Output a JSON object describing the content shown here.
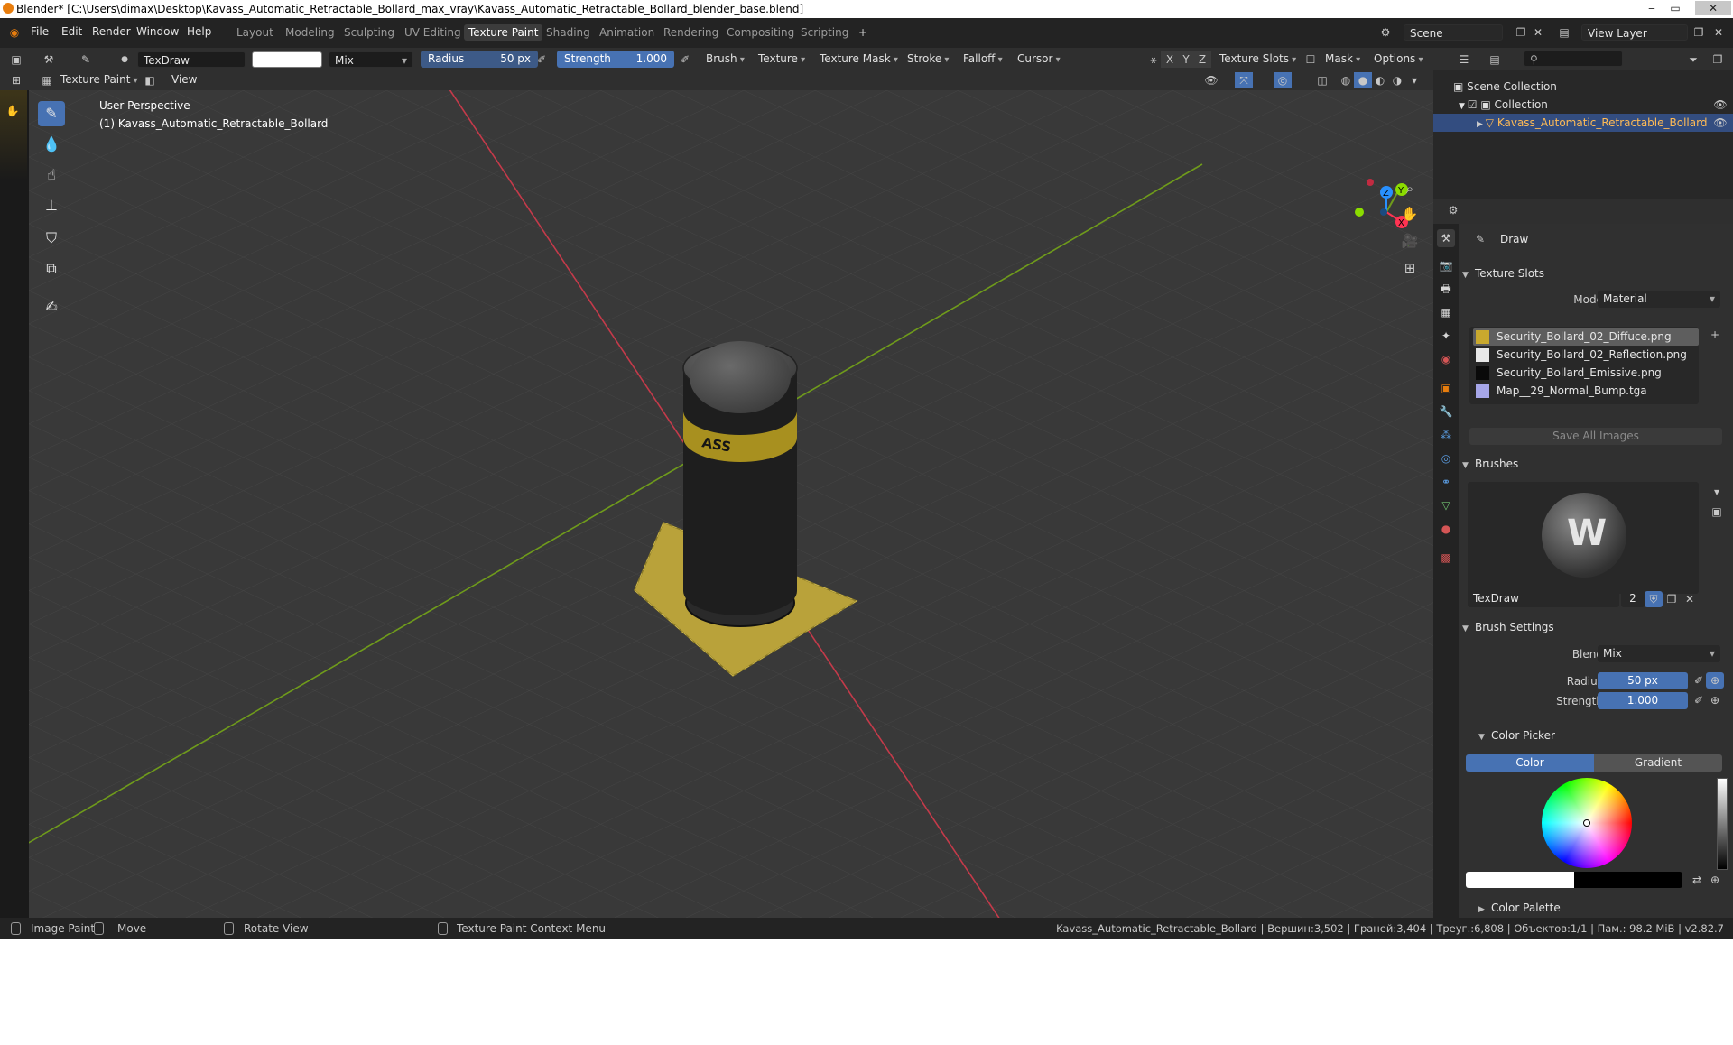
{
  "window": {
    "title": "Blender* [C:\\Users\\dimax\\Desktop\\Kavass_Automatic_Retractable_Bollard_max_vray\\Kavass_Automatic_Retractable_Bollard_blender_base.blend]",
    "minimize": "‒",
    "maximize": "▭",
    "close": "✕"
  },
  "menu": {
    "file": "File",
    "edit": "Edit",
    "render": "Render",
    "window": "Window",
    "help": "Help"
  },
  "workspaces": [
    "Layout",
    "Modeling",
    "Sculpting",
    "UV Editing",
    "Texture Paint",
    "Shading",
    "Animation",
    "Rendering",
    "Compositing",
    "Scripting"
  ],
  "active_workspace": "Texture Paint",
  "add_workspace": "+",
  "scene": {
    "name": "Scene",
    "view_layer": "View Layer"
  },
  "toolheader": {
    "brush_name": "TexDraw",
    "blend": "Mix",
    "radius_label": "Radius",
    "radius_value": "50 px",
    "strength_label": "Strength",
    "strength_value": "1.000",
    "brush": "Brush",
    "texture": "Texture",
    "texture_mask": "Texture Mask",
    "stroke": "Stroke",
    "falloff": "Falloff",
    "cursor": "Cursor",
    "axis_x": "X",
    "axis_y": "Y",
    "axis_z": "Z",
    "texture_slots": "Texture Slots",
    "mask": "Mask",
    "options": "Options"
  },
  "viewheader": {
    "mode": "Texture Paint",
    "view": "View"
  },
  "viewport": {
    "perspective": "User Perspective",
    "object": "(1) Kavass_Automatic_Retractable_Bollard",
    "bollard_text": "ASS",
    "gizmo": {
      "x": "X",
      "y": "Y",
      "z": "Z"
    }
  },
  "outliner": {
    "scene_collection": "Scene Collection",
    "collection": "Collection",
    "object": "Kavass_Automatic_Retractable_Bollard"
  },
  "properties": {
    "tool_name": "Draw",
    "texture_slots_title": "Texture Slots",
    "mode_label": "Mode",
    "mode_value": "Material",
    "slots": [
      {
        "name": "Security_Bollard_02_Diffuce.png",
        "color": "#c9a92e"
      },
      {
        "name": "Security_Bollard_02_Reflection.png",
        "color": "#e8e8e8"
      },
      {
        "name": "Security_Bollard_Emissive.png",
        "color": "#0a0a0a"
      },
      {
        "name": "Map__29_Normal_Bump.tga",
        "color": "#a6a6e8"
      }
    ],
    "save_all": "Save All Images",
    "brushes_title": "Brushes",
    "brush_name": "TexDraw",
    "brush_users": "2",
    "brush_settings_title": "Brush Settings",
    "blend_label": "Blend",
    "blend_value": "Mix",
    "radius_label": "Radius",
    "radius_value": "50 px",
    "strength_label": "Strength",
    "strength_value": "1.000",
    "color_picker_title": "Color Picker",
    "color_tab": "Color",
    "gradient_tab": "Gradient",
    "color_palette_title": "Color Palette"
  },
  "statusbar": {
    "image_paint": "Image Paint",
    "move": "Move",
    "rotate_view": "Rotate View",
    "context_menu": "Texture Paint Context Menu",
    "stats": "Kavass_Automatic_Retractable_Bollard | Вершин:3,502 | Граней:3,404 | Треуг.:6,808 | Объектов:1/1 | Пам.: 98.2 MiB | v2.82.7"
  },
  "colors": {
    "accent": "#4772b3",
    "x_axis": "#ff3352",
    "y_axis": "#8bdc00",
    "z_axis": "#2890ff",
    "brush_color": "#ffffff"
  }
}
